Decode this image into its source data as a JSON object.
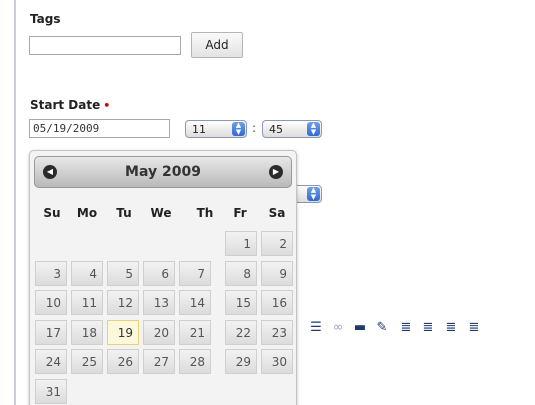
{
  "form": {
    "tags_label": "Tags",
    "tags_value": "",
    "add_button_label": "Add",
    "start_date_label": "Start Date",
    "required_marker": "•",
    "start_date_value": "05/19/2009",
    "hour_value": "11",
    "time_separator": ":",
    "minute_value": "45"
  },
  "datepicker": {
    "title": "May 2009",
    "prev_icon": "chevron-left-icon",
    "next_icon": "chevron-right-icon",
    "weekdays": [
      "Su",
      "Mo",
      "Tu",
      "We",
      "Th",
      "Fr",
      "Sa"
    ],
    "weeks": [
      [
        "",
        "",
        "",
        "",
        "",
        "1",
        "2"
      ],
      [
        "3",
        "4",
        "5",
        "6",
        "7",
        "8",
        "9"
      ],
      [
        "10",
        "11",
        "12",
        "13",
        "14",
        "15",
        "16"
      ],
      [
        "17",
        "18",
        "19",
        "20",
        "21",
        "22",
        "23"
      ],
      [
        "24",
        "25",
        "26",
        "27",
        "28",
        "29",
        "30"
      ],
      [
        "31",
        "",
        "",
        "",
        "",
        "",
        ""
      ]
    ],
    "today": "19"
  },
  "toolbar": {
    "icons": [
      "list-icon",
      "link-icon",
      "horizontal-rule-icon",
      "eraser-icon",
      "align-center-icon",
      "align-left-icon",
      "align-right-icon",
      "align-justify-icon"
    ]
  },
  "colors": {
    "accent": "#2f6ad1",
    "required": "#dd0000"
  }
}
